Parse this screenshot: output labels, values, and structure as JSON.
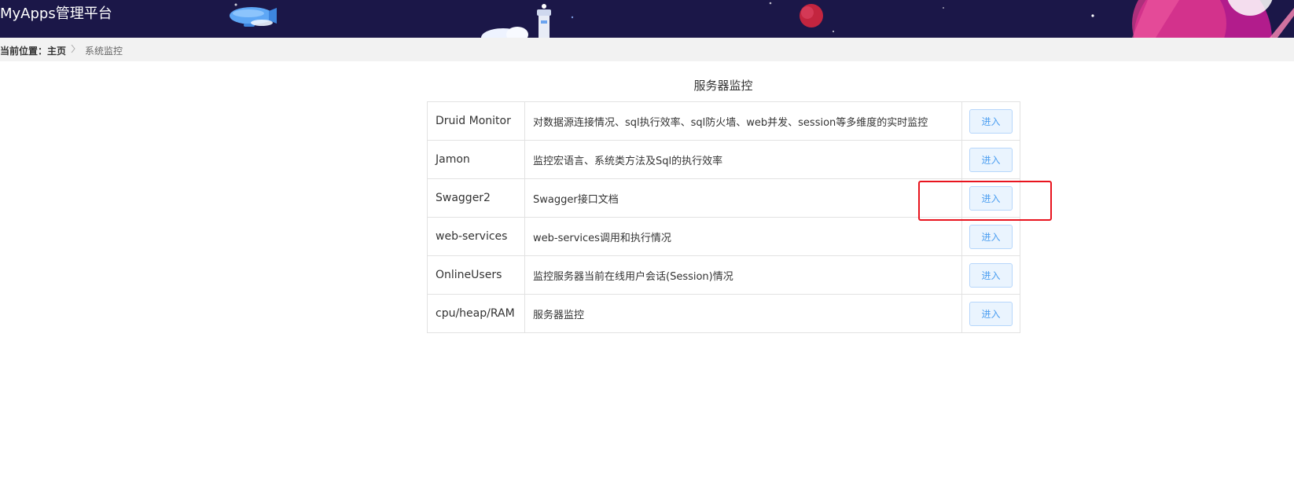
{
  "header": {
    "app_title": "MyApps管理平台"
  },
  "breadcrumb": {
    "current_label": "当前位置：主页",
    "separator": ">",
    "page": "系统监控"
  },
  "main": {
    "section_title": "服务器监控",
    "rows": [
      {
        "name": "Druid Monitor",
        "description": "对数据源连接情况、sql执行效率、sql防火墙、web并发、session等多维度的实时监控",
        "action": "进入"
      },
      {
        "name": "Jamon",
        "description": "监控宏语言、系统类方法及Sql的执行效率",
        "action": "进入"
      },
      {
        "name": "Swagger2",
        "description": "Swagger接口文档",
        "action": "进入"
      },
      {
        "name": "web-services",
        "description": "web-services调用和执行情况",
        "action": "进入"
      },
      {
        "name": "OnlineUsers",
        "description": "监控服务器当前在线用户会话(Session)情况",
        "action": "进入"
      },
      {
        "name": "cpu/heap/RAM",
        "description": "服务器监控",
        "action": "进入"
      }
    ]
  },
  "colors": {
    "header_bg": "#1b1748",
    "button_bg": "#eaf4fe",
    "button_text": "#4d9ff1",
    "highlight": "#e8141e"
  }
}
